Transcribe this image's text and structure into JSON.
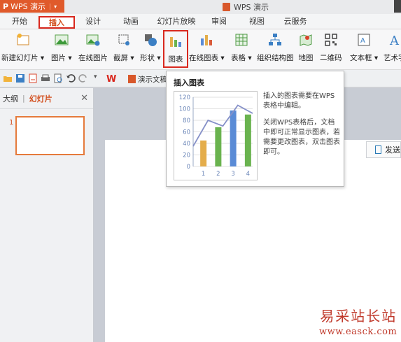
{
  "app": {
    "name": "WPS 演示",
    "doc_title": "WPS 演示"
  },
  "menu": {
    "tabs": [
      {
        "label": "开始"
      },
      {
        "label": "插入",
        "active": true
      },
      {
        "label": "设计"
      },
      {
        "label": "动画"
      },
      {
        "label": "幻灯片放映"
      },
      {
        "label": "审阅"
      },
      {
        "label": "视图"
      },
      {
        "label": "云服务"
      }
    ]
  },
  "ribbon": {
    "buttons": [
      {
        "label": "新建幻灯片 ▾",
        "icon": "new-slide-icon"
      },
      {
        "label": "图片 ▾",
        "icon": "picture-icon"
      },
      {
        "label": "在线图片",
        "icon": "online-picture-icon"
      },
      {
        "label": "截屏 ▾",
        "icon": "screenshot-icon"
      },
      {
        "label": "形状 ▾",
        "icon": "shape-icon"
      },
      {
        "label": "图表",
        "icon": "chart-icon",
        "highlighted": true
      },
      {
        "label": "在线图表 ▾",
        "icon": "online-chart-icon"
      },
      {
        "label": "表格 ▾",
        "icon": "table-icon"
      },
      {
        "label": "组织结构图",
        "icon": "org-chart-icon"
      },
      {
        "label": "地图",
        "icon": "map-icon"
      },
      {
        "label": "二维码",
        "icon": "qr-code-icon"
      },
      {
        "label": "文本框 ▾",
        "icon": "textbox-icon"
      },
      {
        "label": "艺术字",
        "icon": "word-art-icon"
      }
    ]
  },
  "document_tab": {
    "label": "演示文稿"
  },
  "left_panel": {
    "tab_outline": "大纲",
    "tab_slides": "幻灯片",
    "slide_number": "1"
  },
  "send_button": {
    "label": "发送"
  },
  "tooltip": {
    "title": "插入图表",
    "line1": "插入的图表需要在WPS表格中编辑。",
    "line2": "关闭WPS表格后，文档中即可正常显示图表，若需要更改图表，双击图表即可。",
    "chart": {
      "y_ticks": [
        "120",
        "100",
        "80",
        "60",
        "40",
        "20",
        "0"
      ],
      "x_ticks": [
        "1",
        "2",
        "3",
        "4"
      ]
    }
  },
  "watermark": {
    "line1": "易采站长站",
    "line2": "www.easck.com"
  },
  "chart_data": {
    "type": "bar",
    "categories": [
      "1",
      "2",
      "3",
      "4"
    ],
    "values": [
      45,
      68,
      97,
      90
    ],
    "bar_colors": [
      "#e4ad4b",
      "#6ab34f",
      "#5a8bd6",
      "#6ab34f"
    ],
    "line_values": [
      35,
      80,
      70,
      106,
      92
    ],
    "ylim": [
      0,
      120
    ],
    "grid": true
  },
  "colors": {
    "accent": "#d24e1d",
    "highlight_border": "#d9281e"
  }
}
